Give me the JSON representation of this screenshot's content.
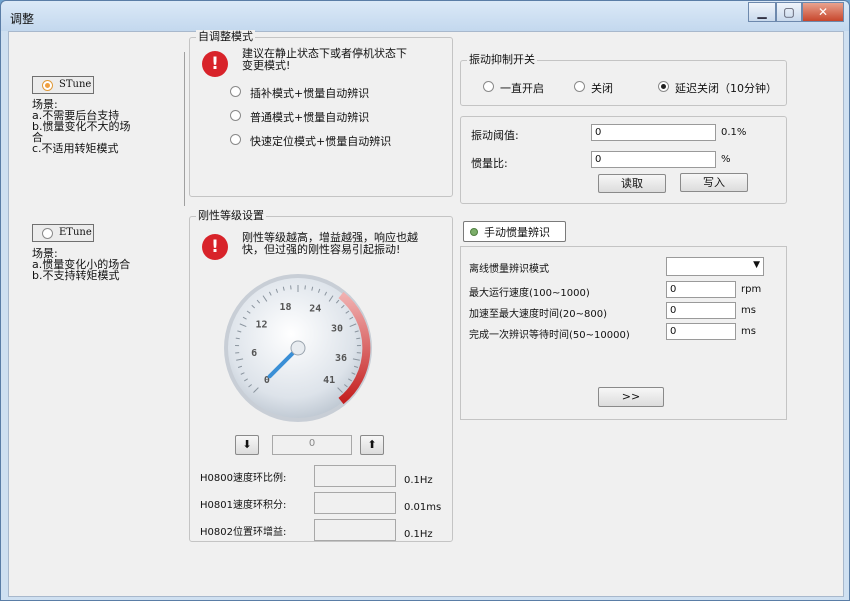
{
  "window": {
    "title": "调整"
  },
  "stune": {
    "label": "STune",
    "scenario_label": "场景:",
    "lines": [
      "a.不需要后台支持",
      "b.惯量变化不大的场",
      "合",
      "c.不适用转矩模式"
    ]
  },
  "etune": {
    "label": "ETune",
    "scenario_label": "场景:",
    "lines": [
      "a.惯量变化小的场合",
      "b.不支持转矩模式"
    ]
  },
  "auto_mode": {
    "title": "自调整模式",
    "warning": [
      "建议在静止状态下或者停机状态下",
      "变更模式!"
    ],
    "options": [
      "插补模式+惯量自动辨识",
      "普通模式+惯量自动辨识",
      "快速定位模式+惯量自动辨识"
    ]
  },
  "vibration": {
    "title": "振动抑制开关",
    "options": [
      "一直开启",
      "关闭",
      "延迟关闭（10分钟）"
    ],
    "selected": 2
  },
  "thresholds": {
    "threshold_label": "振动阈值:",
    "threshold_value": "0",
    "threshold_unit": "0.1%",
    "inertia_label": "惯量比:",
    "inertia_value": "0",
    "inertia_unit": "%",
    "read_label": "读取",
    "write_label": "写入"
  },
  "stiffness": {
    "title": "刚性等级设置",
    "warning": [
      "刚性等级越高，增益越强，响应也越",
      "快，但过强的刚性容易引起振动!"
    ],
    "dial_ticks": [
      "0",
      "6",
      "12",
      "18",
      "24",
      "30",
      "36",
      "41"
    ],
    "level": 0,
    "level_display": "0",
    "params": [
      {
        "label": "H0800速度环比例:",
        "value": "",
        "unit": "0.1Hz"
      },
      {
        "label": "H0801速度环积分:",
        "value": "",
        "unit": "0.01ms"
      },
      {
        "label": "H0802位置环增益:",
        "value": "",
        "unit": "0.1Hz"
      }
    ]
  },
  "manual": {
    "tab_label": "手动惯量辨识",
    "mode_label": "离线惯量辨识模式",
    "mode_value": "",
    "rows": [
      {
        "label": "最大运行速度(100~1000)",
        "value": "0",
        "unit": "rpm"
      },
      {
        "label": "加速至最大速度时间(20~800)",
        "value": "0",
        "unit": "ms"
      },
      {
        "label": "完成一次辨识等待时间(50~10000)",
        "value": "0",
        "unit": "ms"
      }
    ],
    "run_label": ">>"
  }
}
